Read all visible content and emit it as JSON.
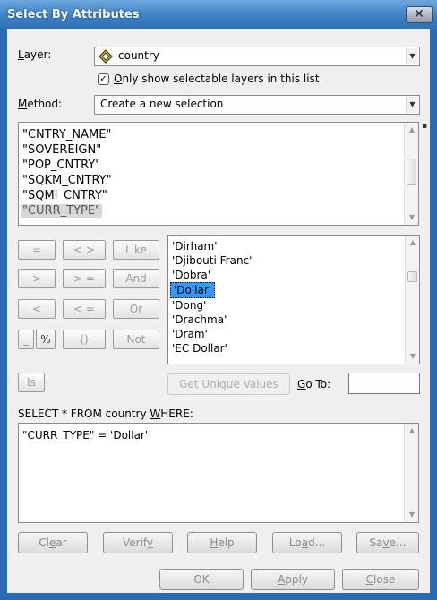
{
  "window": {
    "title": "Select By Attributes",
    "close_glyph": "✕"
  },
  "layer": {
    "label": "Layer:",
    "value": "country",
    "icon": "layer-diamond-icon",
    "only_selectable_checked": true,
    "only_selectable_label": "Only show selectable layers in this list"
  },
  "method": {
    "label": "Method:",
    "value": "Create a new selection"
  },
  "fields": [
    "\"CNTRY_NAME\"",
    "\"SOVEREIGN\"",
    "\"POP_CNTRY\"",
    "\"SQKM_CNTRY\"",
    "\"SQMI_CNTRY\"",
    "\"CURR_TYPE\""
  ],
  "selected_field": "\"CURR_TYPE\"",
  "operators": {
    "eq": "=",
    "ne": "< >",
    "like": "Like",
    "gt": ">",
    "ge": "> =",
    "and": "And",
    "lt": "<",
    "le": "< =",
    "or": "Or",
    "underscore": "_",
    "percent": "%",
    "parens": "()",
    "not": "Not",
    "is": "Is"
  },
  "values": [
    "'Dirham'",
    "'Djibouti Franc'",
    "'Dobra'",
    "'Dollar'",
    "'Dong'",
    "'Drachma'",
    "'Dram'",
    "'EC Dollar'"
  ],
  "selected_value": "'Dollar'",
  "get_unique_label": "Get Unique Values",
  "goto": {
    "label": "Go To:",
    "value": ""
  },
  "sql": {
    "prefix": "SELECT * FROM country WHERE:",
    "expression": "\"CURR_TYPE\" = 'Dollar'"
  },
  "buttons": {
    "clear": "Clear",
    "verify": "Verify",
    "help": "Help",
    "load": "Load...",
    "save": "Save...",
    "ok": "OK",
    "apply": "Apply",
    "close": "Close"
  },
  "colors": {
    "title_blue": "#3f82c7",
    "selection": "#3399ff"
  }
}
